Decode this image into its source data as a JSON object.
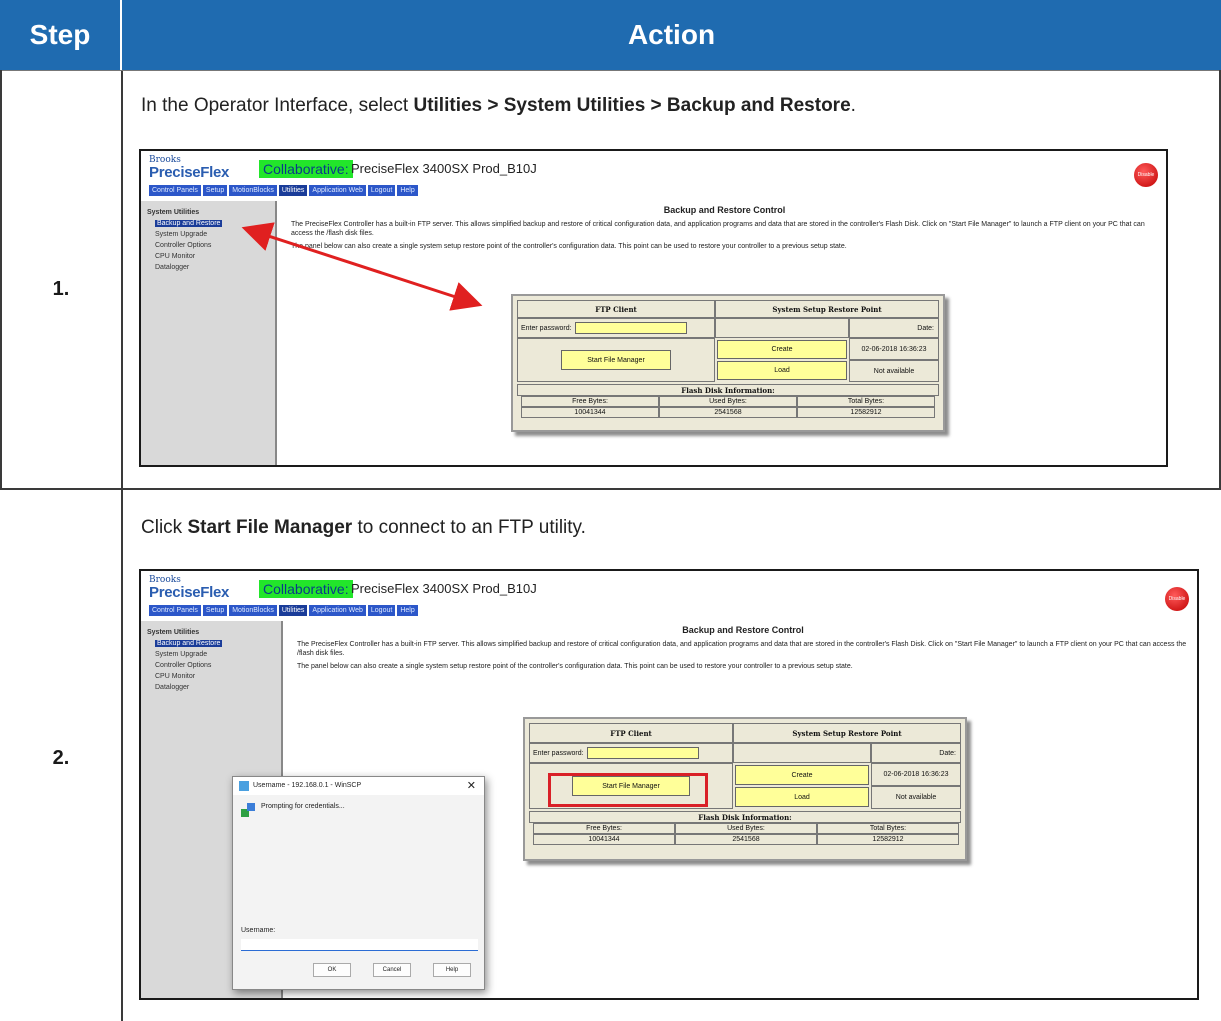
{
  "header": {
    "step": "Step",
    "action": "Action"
  },
  "rows": [
    {
      "step": "1.",
      "instruction_prefix": "In the Operator Interface, select ",
      "instruction_bold": "Utilities > System Utilities > Backup and Restore",
      "instruction_suffix": "."
    },
    {
      "step": "2.",
      "instruction_prefix": "Click ",
      "instruction_bold": "Start File Manager",
      "instruction_suffix": " to connect to an FTP utility."
    }
  ],
  "screenshot": {
    "brand_small": "Brooks",
    "brand": "PreciseFlex",
    "collab": "Collaborative:",
    "title": "PreciseFlex 3400SX Prod_B10J",
    "power": "Disable Power",
    "nav": [
      "Control Panels",
      "Setup",
      "MotionBlocks",
      "Utilities",
      "Application Web",
      "Logout",
      "Help"
    ],
    "sidebar": [
      "System Utilities",
      "Backup and Restore",
      "System Upgrade",
      "Controller Options",
      "CPU Monitor",
      "Datalogger"
    ],
    "panel_title": "Backup and Restore Control",
    "para1": "The PreciseFlex Controller has a built-in FTP server. This allows simplified backup and restore of critical configuration data, and application programs and data that are stored in the controller's Flash Disk. Click on \"Start File Manager\" to launch a FTP client on your PC that can access the /flash disk files.",
    "para2": "The panel below can also create a single system setup restore point of the controller's configuration data. This point can be used to restore your controller to a previous setup state.",
    "ftp_client": "FTP Client",
    "restore_point": "System Setup Restore Point",
    "enter_password": "Enter password:",
    "date_label": "Date:",
    "start_fm": "Start File Manager",
    "create": "Create",
    "load": "Load",
    "date_value": "02-06-2018 16:36:23",
    "not_available": "Not available",
    "flash_info": "Flash Disk Information:",
    "free_label": "Free Bytes:",
    "used_label": "Used Bytes:",
    "total_label": "Total Bytes:",
    "free_val": "10041344",
    "used_val": "2541568",
    "total_val": "12582912"
  },
  "winscp": {
    "title": "Username - 192.168.0.1 - WinSCP",
    "message": "Prompting for credentials...",
    "username_label": "Username:",
    "ok": "OK",
    "cancel": "Cancel",
    "help": "Help"
  },
  "colors": {
    "header_bg": "#1f6bb0",
    "collab_green": "#22e62a",
    "highlight_red": "#d92027",
    "field_yellow": "#ffff99"
  }
}
